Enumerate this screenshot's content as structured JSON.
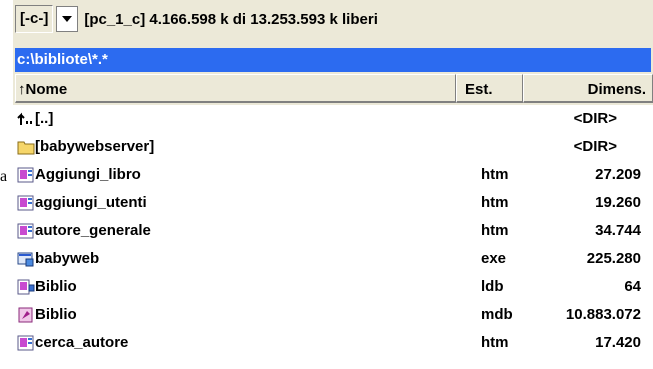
{
  "drive": {
    "label": "[-c-]",
    "info": "[pc_1_c]  4.166.598 k di 13.253.593 k liberi",
    "dropdown_icon": "chevron-down-icon"
  },
  "path": "c:\\bibliote\\*.*",
  "columns": {
    "name": "↑Nome",
    "ext": "Est.",
    "size": "Dimens."
  },
  "stray_text": "a",
  "colors": {
    "path_bar": "#2c6bf0",
    "panel": "#ece9d8"
  },
  "rows": [
    {
      "name": "[..]",
      "ext": "",
      "size": "<DIR>",
      "icon": "up-folder-icon"
    },
    {
      "name": "[babywebserver]",
      "ext": "",
      "size": "<DIR>",
      "icon": "folder-icon"
    },
    {
      "name": "Aggiungi_libro",
      "ext": "htm",
      "size": "27.209",
      "icon": "html-file-icon"
    },
    {
      "name": "aggiungi_utenti",
      "ext": "htm",
      "size": "19.260",
      "icon": "html-file-icon"
    },
    {
      "name": "autore_generale",
      "ext": "htm",
      "size": "34.744",
      "icon": "html-file-icon"
    },
    {
      "name": "babyweb",
      "ext": "exe",
      "size": "225.280",
      "icon": "exe-file-icon"
    },
    {
      "name": "Biblio",
      "ext": "ldb",
      "size": "64",
      "icon": "ldb-file-icon"
    },
    {
      "name": "Biblio",
      "ext": "mdb",
      "size": "10.883.072",
      "icon": "access-db-icon"
    },
    {
      "name": "cerca_autore",
      "ext": "htm",
      "size": "17.420",
      "icon": "html-file-icon"
    }
  ]
}
